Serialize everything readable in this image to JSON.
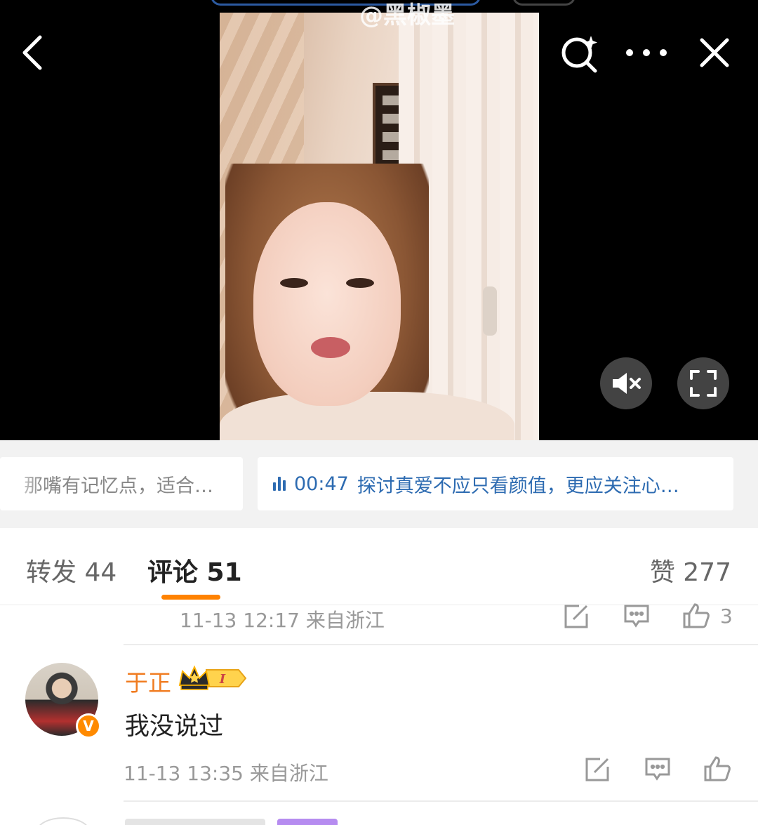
{
  "video": {
    "watermark": "@黑椒墨",
    "icons": {
      "back": "chevron-left-icon",
      "search": "search-sparkle-icon",
      "more": "more-dots-icon",
      "close": "close-icon",
      "mute": "speaker-mute-icon",
      "fullscreen": "fullscreen-icon"
    }
  },
  "chips": [
    {
      "text": "那嘴有记忆点，适合…"
    },
    {
      "time": "00:47",
      "text": "探讨真爱不应只看颜值，更应关注心…"
    }
  ],
  "tabs": {
    "repost": "转发 44",
    "comment": "评论 51",
    "like": "赞 277",
    "active": "comment",
    "accent_color": "#ff8200"
  },
  "previous_comment": {
    "meta": "11-13 12:17  来自浙江",
    "like_count": "3"
  },
  "comment": {
    "username": "于正",
    "username_color": "#f07c21",
    "badge_level": "I",
    "verified_mark": "V",
    "text": "我没说过",
    "meta": "11-13 13:35  来自浙江"
  }
}
